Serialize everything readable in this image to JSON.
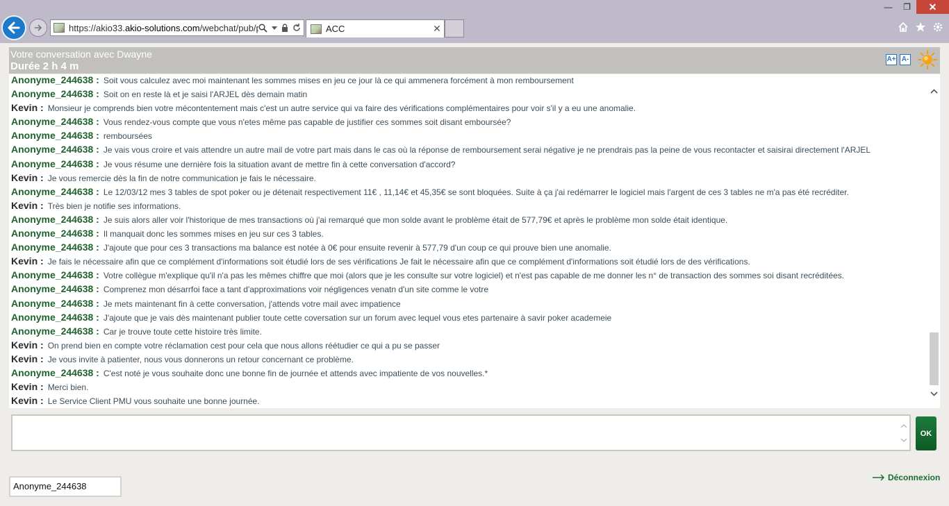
{
  "browser": {
    "url_prefix": "https://akio33.",
    "url_domain": "akio-solutions.com",
    "url_path": "/webchat/pub/pa",
    "tab_title": "ACC",
    "window_controls": [
      "—",
      "❐",
      "✕"
    ]
  },
  "chat": {
    "title": "Votre conversation avec Dwayne",
    "duration": "Durée 2 h 4 m",
    "font_increase_label": "A+",
    "font_decrease_label": "A-",
    "messages": [
      {
        "sender": "Anonyme_244638 :",
        "role": "client",
        "text": "Soit vous calculez avec moi maintenant les sommes mises en jeu ce jour là ce qui ammenera forcément à mon remboursement"
      },
      {
        "sender": "Anonyme_244638 :",
        "role": "client",
        "text": "Soit on en reste là et je saisi l'ARJEL dès demain matin"
      },
      {
        "sender": "Kevin :",
        "role": "agent",
        "text": "Monsieur je comprends bien votre mécontentement mais c'est un autre service qui va faire des vérifications complémentaires pour voir s'il y a eu une anomalie."
      },
      {
        "sender": "Anonyme_244638 :",
        "role": "client",
        "text": "Vous rendez-vous compte que vous n'etes même pas capable de justifier ces sommes soit disant emboursée?"
      },
      {
        "sender": "Anonyme_244638 :",
        "role": "client",
        "text": "remboursées"
      },
      {
        "sender": "Anonyme_244638 :",
        "role": "client",
        "text": "Je vais vous croire et vais attendre un autre mail de votre part mais dans le cas où la réponse de remboursement serai négative je ne prendrais pas la peine de vous recontacter et saisirai directement l'ARJEL"
      },
      {
        "sender": "Anonyme_244638 :",
        "role": "client",
        "text": "Je vous résume une dernière fois la situation avant de mettre fin à cette conversation d'accord?"
      },
      {
        "sender": "Kevin :",
        "role": "agent",
        "text": "Je vous remercie dès la fin de notre communication je fais le nécessaire."
      },
      {
        "sender": "Anonyme_244638 :",
        "role": "client",
        "text": "Le 12/03/12 mes 3 tables de spot poker ou je détenait respectivement 11€ , 11,14€ et 45,35€ se sont bloquées. Suite à ça j'ai redémarrer le logiciel mais l'argent de ces 3 tables ne m'a pas été recréditer."
      },
      {
        "sender": "Kevin :",
        "role": "agent",
        "text": "Très bien je notifie ses informations."
      },
      {
        "sender": "Anonyme_244638 :",
        "role": "client",
        "text": "Je suis alors aller voir l'historique de mes transactions où j'ai remarqué que mon solde avant le problème était de 577,79€ et après le problème mon solde était identique."
      },
      {
        "sender": "Anonyme_244638 :",
        "role": "client",
        "text": "Il manquait donc les sommes mises en jeu sur ces 3 tables."
      },
      {
        "sender": "Anonyme_244638 :",
        "role": "client",
        "text": "J'ajoute que pour ces 3 transactions ma balance est notée à 0€ pour ensuite revenir à 577,79 d'un coup ce qui prouve bien une anomalie."
      },
      {
        "sender": "Kevin :",
        "role": "agent",
        "text": "Je fais le nécessaire afin que ce complément d'informations soit étudié lors de ses vérifications Je fait le nécessaire afin que ce complément d'informations soit étudié lors de des vérifications."
      },
      {
        "sender": "Anonyme_244638 :",
        "role": "client",
        "text": "Votre collègue m'explique qu'il n'a pas les mêmes chiffre que moi (alors que je les consulte sur votre logiciel) et n'est pas capable de me donner les n° de transaction des sommes soi disant recréditées."
      },
      {
        "sender": "Anonyme_244638 :",
        "role": "client",
        "text": "Comprenez mon désarrfoi face a tant d'approximations voir négligences venatn d'un site comme le votre"
      },
      {
        "sender": "Anonyme_244638 :",
        "role": "client",
        "text": "Je mets maintenant fin à cette conversation, j'attends votre mail avec impatience"
      },
      {
        "sender": "Anonyme_244638 :",
        "role": "client",
        "text": "J'ajoute que je vais dès maintenant publier toute cette coversation sur un forum avec lequel vous etes partenaire à savir poker academeie"
      },
      {
        "sender": "Anonyme_244638 :",
        "role": "client",
        "text": "Car je trouve toute cette histoire très limite."
      },
      {
        "sender": "Kevin :",
        "role": "agent",
        "text": "On prend bien en compte votre réclamation cest pour cela que nous allons réétudier ce qui a pu se passer"
      },
      {
        "sender": "Kevin :",
        "role": "agent",
        "text": "Je vous invite à patienter, nous vous donnerons un retour concernant ce problème."
      },
      {
        "sender": "Anonyme_244638 :",
        "role": "client",
        "text": "C'est noté je vous souhaite donc une bonne fin de journée et attends avec impatiente de vos nouvelles.*"
      },
      {
        "sender": "Kevin :",
        "role": "agent",
        "text": "Merci bien."
      },
      {
        "sender": "Kevin :",
        "role": "agent",
        "text": "Le Service Client PMU vous souhaite une bonne journée."
      }
    ]
  },
  "composer": {
    "value": "",
    "send_label": "OK"
  },
  "footer": {
    "username": "Anonyme_244638",
    "logout_label": "Déconnexion"
  },
  "colors": {
    "client_name": "#21632e",
    "agent_name": "#2b2b2b",
    "header_bg": "#c1c0bc",
    "send_button": "#1d7a3c"
  }
}
